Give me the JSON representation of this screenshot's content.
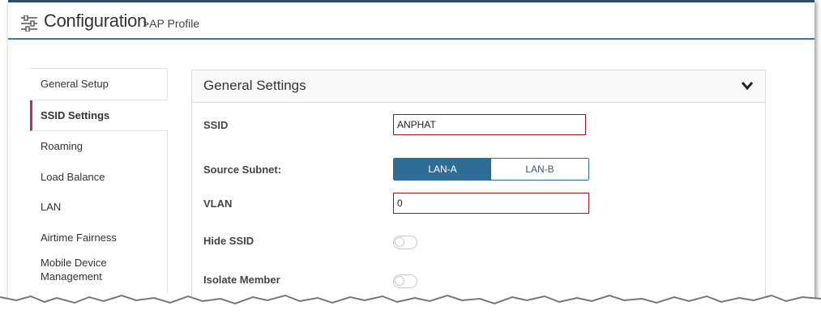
{
  "header": {
    "title": "Configuration",
    "breadcrumb": ">AP Profile",
    "icon": "sliders-icon"
  },
  "sidebar": {
    "items": [
      {
        "label": "General Setup",
        "active": false
      },
      {
        "label": "SSID Settings",
        "active": true
      },
      {
        "label": "Roaming",
        "active": false
      },
      {
        "label": "Load Balance",
        "active": false
      },
      {
        "label": "LAN",
        "active": false
      },
      {
        "label": "Airtime Fairness",
        "active": false
      },
      {
        "label": "Mobile Device Management",
        "active": false
      }
    ]
  },
  "panel": {
    "title": "General Settings",
    "collapse_icon": "chevron-down-icon",
    "fields": {
      "ssid": {
        "label": "SSID",
        "value": "ANPHAT"
      },
      "source_subnet": {
        "label": "Source Subnet:",
        "options": [
          "LAN-A",
          "LAN-B"
        ],
        "selected": "LAN-A"
      },
      "vlan": {
        "label": "VLAN",
        "value": "0"
      },
      "hide_ssid": {
        "label": "Hide SSID",
        "enabled": false
      },
      "isolate_member": {
        "label": "Isolate Member",
        "enabled": false
      }
    }
  },
  "colors": {
    "accent": "#2e6d96",
    "error_border": "#a4131b",
    "active_marker": "#b0344a"
  }
}
